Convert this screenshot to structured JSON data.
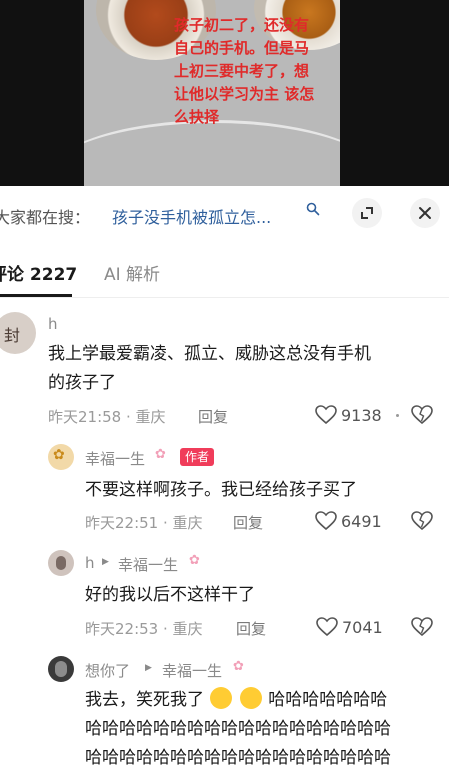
{
  "video": {
    "caption": "孩子初二了，还没有\n自己的手机。但是马\n上初三要中考了，想\n让他以学习为主 该怎\n么抉择"
  },
  "search": {
    "prefix": "大家都在搜：",
    "query": "孩子没手机被孤立怎...",
    "search_icon": "search-icon",
    "expand_icon": "expand-icon",
    "close_icon": "close-icon"
  },
  "tabs": [
    {
      "label": "评论 2227"
    },
    {
      "label": "AI 解析"
    }
  ],
  "comments": [
    {
      "username": "h",
      "avatar_text": "封",
      "text_line1": "我上学最爱霸凌、孤立、威胁这总没有手机",
      "text_line2": "的孩子了",
      "time_location": "昨天21:58 · 重庆",
      "reply_label": "回复",
      "likes": "9138"
    },
    {
      "username": "幸福一生",
      "author_badge": "作者",
      "text_line1": "不要这样啊孩子。我已经给孩子买了",
      "time_location": "昨天22:51 · 重庆",
      "reply_label": "回复",
      "likes": "6491"
    },
    {
      "username": "h",
      "reply_to": "幸福一生",
      "text_line1": "好的我以后不这样干了",
      "time_location": "昨天22:53 · 重庆",
      "reply_label": "回复",
      "likes": "7041"
    },
    {
      "username": "想你了",
      "reply_to": "幸福一生",
      "text_prefix": "我去，笑死我了",
      "text_suffix": "哈哈哈哈哈哈哈",
      "text_line2": "哈哈哈哈哈哈哈哈哈哈哈哈哈哈哈哈哈哈",
      "text_line3": "哈哈哈哈哈哈哈哈哈哈哈哈哈哈哈哈哈哈"
    }
  ],
  "colors": {
    "accent_red": "#e02a2a",
    "link_blue": "#2f5f9c",
    "author_badge": "#f03c5a"
  }
}
